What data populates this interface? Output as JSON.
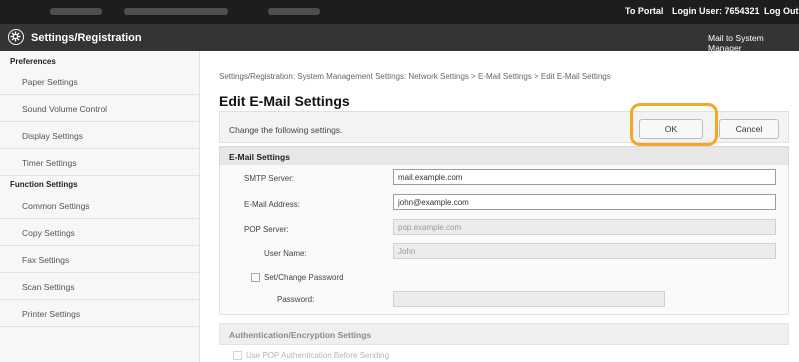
{
  "topbar": {
    "portal": "To Portal",
    "login_user": "Login User: 7654321",
    "logout": "Log Out"
  },
  "app": {
    "title": "Settings/Registration",
    "mail_link": "Mail to System Manager"
  },
  "sidebar": {
    "groups": [
      {
        "heading": "Preferences",
        "items": [
          "Paper Settings",
          "Sound Volume Control",
          "Display Settings",
          "Timer Settings"
        ]
      },
      {
        "heading": "Function Settings",
        "items": [
          "Common Settings",
          "Copy Settings",
          "Fax Settings",
          "Scan Settings",
          "Printer Settings"
        ]
      }
    ]
  },
  "main": {
    "breadcrumb": "Settings/Registration: System Management Settings: Network Settings > E-Mail Settings > Edit E-Mail Settings",
    "title": "Edit E-Mail Settings",
    "instruction": "Change the following settings.",
    "ok_label": "OK",
    "cancel_label": "Cancel",
    "email_section": {
      "heading": "E-Mail Settings",
      "smtp_label": "SMTP Server:",
      "smtp_value": "mail.example.com",
      "address_label": "E-Mail Address:",
      "address_value": "john@example.com",
      "pop_label": "POP Server:",
      "pop_value": "pop.example.com",
      "username_label": "User Name:",
      "username_value": "John",
      "set_password_label": "Set/Change Password",
      "password_label": "Password:",
      "password_value": ""
    },
    "auth_section": {
      "heading": "Authentication/Encryption Settings",
      "pop_before_smtp_label": "Use POP Authentication Before Sending"
    }
  },
  "colors": {
    "topbar": "#1d1d1d",
    "titlebar": "#343434",
    "highlight": "#f5a623"
  }
}
